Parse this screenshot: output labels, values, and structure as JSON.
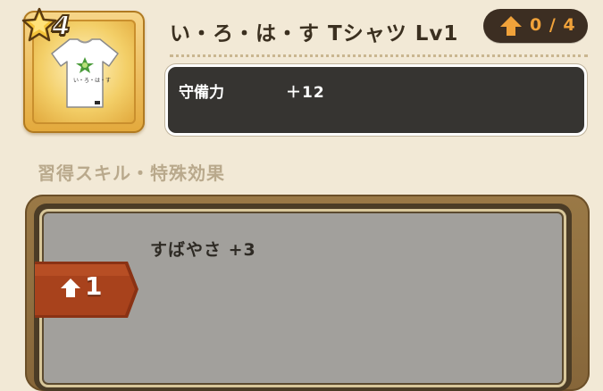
{
  "item": {
    "rarity_stars": 4,
    "rarity_label": "4",
    "name": "い・ろ・は・す Tシャツ Lv1",
    "icon": "tshirt-icon",
    "shirt_logo_text": "い・ろ・は・す"
  },
  "upgrade": {
    "icon": "upgrade-arrow-icon",
    "count": "0 / 4",
    "current": 0,
    "max": 4
  },
  "stats": [
    {
      "label": "守備力",
      "value": "＋12"
    }
  ],
  "skills_section": {
    "title": "習得スキル・特殊効果",
    "skills": [
      {
        "unlock_level": "1",
        "icon": "upgrade-arrow-icon",
        "text": "すばやさ +3"
      }
    ]
  },
  "colors": {
    "background": "#f2e9d6",
    "gold_frame": "#e3a93c",
    "stat_box": "#363431",
    "upgrade_accent": "#f0a23a",
    "level_tag": "#a8421c",
    "skill_panel": "#a2a09c"
  }
}
